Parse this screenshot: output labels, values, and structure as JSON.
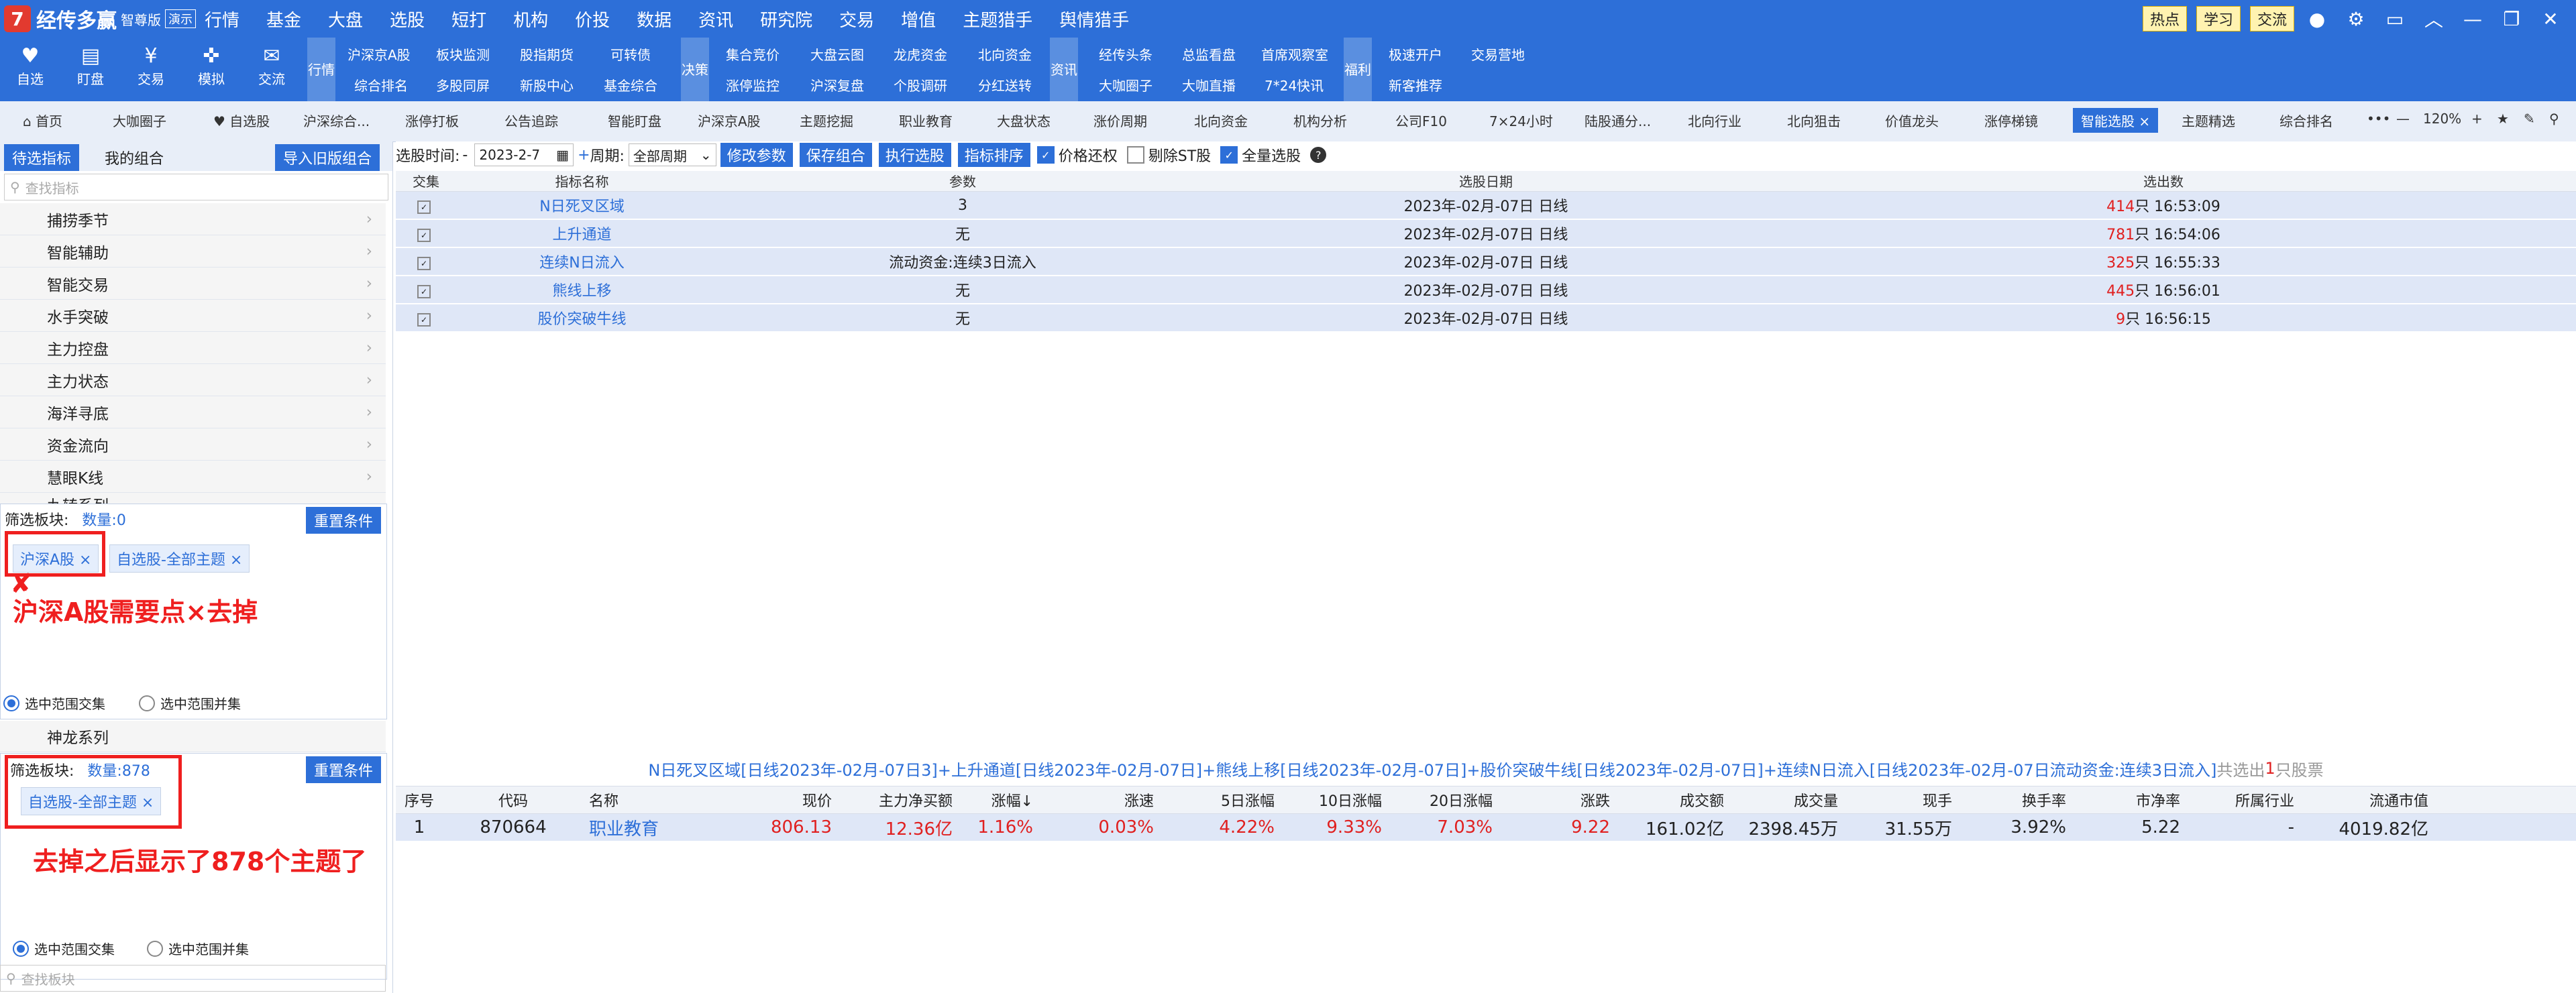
{
  "app": {
    "logo_glyph": "7",
    "brand": "经传多赢",
    "edition": "智尊版",
    "demo": "演示",
    "nav": [
      "行情",
      "基金",
      "大盘",
      "选股",
      "短打",
      "机构",
      "价投",
      "数据",
      "资讯",
      "研究院",
      "交易",
      "增值",
      "主题猎手",
      "舆情猎手"
    ],
    "right_tags": [
      "热点",
      "学习",
      "交流"
    ]
  },
  "ribbon": {
    "buttons": [
      {
        "label": "自选",
        "icon": "heart-icon"
      },
      {
        "label": "盯盘",
        "icon": "chart-icon"
      },
      {
        "label": "交易",
        "icon": "yen-icon"
      },
      {
        "label": "模拟",
        "icon": "gamepad-icon"
      },
      {
        "label": "交流",
        "icon": "chat-icon"
      }
    ],
    "vtabs": [
      "行情",
      "决策",
      "资讯",
      "福利"
    ],
    "links_row1": [
      "沪深京A股",
      "板块监测",
      "股指期货",
      "可转债",
      "集合竞价",
      "大盘云图",
      "龙虎资金",
      "北向资金",
      "经传头条",
      "总监看盘",
      "首席观察室",
      "极速开户",
      "交易营地"
    ],
    "links_row2": [
      "综合排名",
      "多股同屏",
      "新股中心",
      "基金综合",
      "涨停监控",
      "沪深复盘",
      "个股调研",
      "分红送转",
      "大咖圈子",
      "大咖直播",
      "7*24快讯",
      "新客推荐"
    ]
  },
  "tabs": [
    "首页",
    "大咖圈子",
    "自选股",
    "沪深综合...",
    "涨停打板",
    "公告追踪",
    "智能盯盘",
    "沪深京A股",
    "主题挖掘",
    "职业教育",
    "大盘状态",
    "涨价周期",
    "北向资金",
    "机构分析",
    "公司F10",
    "7×24小时",
    "陆股通分...",
    "北向行业",
    "北向狙击",
    "价值龙头",
    "涨停梯镜",
    "智能选股",
    "主题精选",
    "综合排名"
  ],
  "tab_active": "智能选股",
  "zoom": "120%",
  "left": {
    "tab_pending": "待选指标",
    "tab_mine": "我的组合",
    "import_btn": "导入旧版组合",
    "search_placeholder": "查找指标",
    "categories": [
      "捕捞季节",
      "智能辅助",
      "智能交易",
      "水手突破",
      "主力控盘",
      "主力状态",
      "海洋寻底",
      "资金流向",
      "慧眼K线"
    ],
    "partial_category": "九转系列",
    "filter1": {
      "title": "筛选板块:",
      "count": "数量:0",
      "reset": "重置条件",
      "chips": [
        "沪深A股 ×",
        "自选股-全部主题 ×"
      ]
    },
    "filter1_note": "沪深A股需要点×去掉",
    "radio_intersect": "选中范围交集",
    "radio_union": "选中范围并集",
    "dragon_series": "神龙系列",
    "filter2": {
      "title": "筛选板块:",
      "count": "数量:878",
      "reset": "重置条件",
      "chips": [
        "自选股-全部主题 ×"
      ]
    },
    "filter2_note": "去掉之后显示了878个主题了",
    "bottom_search_placeholder": "查找板块"
  },
  "toolbar": {
    "time_label": "选股时间:",
    "date": "2023-2-7",
    "period_label": "周期:",
    "period": "全部周期",
    "buttons": [
      "修改参数",
      "保存组合",
      "执行选股",
      "指标排序"
    ],
    "checks": [
      {
        "label": "价格还权",
        "on": true
      },
      {
        "label": "剔除ST股",
        "on": false
      },
      {
        "label": "全量选股",
        "on": true
      }
    ]
  },
  "grid": {
    "headers": [
      "交集",
      "指标名称",
      "参数",
      "选股日期",
      "选出数"
    ],
    "rows": [
      {
        "name": "N日死叉区域",
        "param": "3",
        "date": "2023年-02月-07日 日线",
        "count": "414",
        "suffix": "只 16:53:09"
      },
      {
        "name": "上升通道",
        "param": "无",
        "date": "2023年-02月-07日 日线",
        "count": "781",
        "suffix": "只 16:54:06"
      },
      {
        "name": "连续N日流入",
        "param": "流动资金:连续3日流入",
        "date": "2023年-02月-07日 日线",
        "count": "325",
        "suffix": "只 16:55:33"
      },
      {
        "name": "熊线上移",
        "param": "无",
        "date": "2023年-02月-07日 日线",
        "count": "445",
        "suffix": "只 16:56:01"
      },
      {
        "name": "股价突破牛线",
        "param": "无",
        "date": "2023年-02月-07日 日线",
        "count": "9",
        "suffix": "只 16:56:15"
      }
    ]
  },
  "summary": {
    "text": "N日死叉区域[日线2023年-02月-07日3]+上升通道[日线2023年-02月-07日]+熊线上移[日线2023年-02月-07日]+股价突破牛线[日线2023年-02月-07日]+连续N日流入[日线2023年-02月-07日流动资金:连续3日流入]",
    "tail": " 共选出",
    "count": "1",
    "unit": "只股票"
  },
  "result": {
    "headers": [
      "序号",
      "代码",
      "名称",
      "现价",
      "主力净买额",
      "涨幅↓",
      "涨速",
      "5日涨幅",
      "10日涨幅",
      "20日涨幅",
      "涨跌",
      "成交额",
      "成交量",
      "现手",
      "换手率",
      "市净率",
      "所属行业",
      "流通市值"
    ],
    "row": [
      "1",
      "870664",
      "职业教育",
      "806.13",
      "12.36亿",
      "1.16%",
      "0.03%",
      "4.22%",
      "9.33%",
      "7.03%",
      "9.22",
      "161.02亿",
      "2398.45万",
      "31.55万",
      "3.92%",
      "5.22",
      "-",
      "4019.82亿"
    ]
  },
  "colors": {
    "accent": "#2d6fd8",
    "alert": "#ef1f1f",
    "row": "#dfe7f7"
  }
}
